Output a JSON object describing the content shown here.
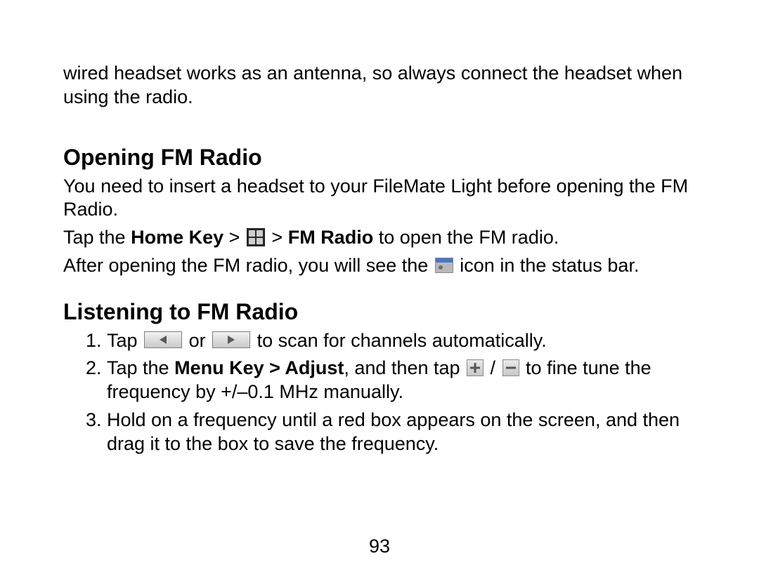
{
  "intro_para": "wired headset works as an antenna, so always connect the headset when using the radio.",
  "section_opening": {
    "heading": "Opening FM Radio",
    "para1": "You need to insert a headset to your FileMate Light before opening the FM Radio.",
    "tap_line": {
      "prefix": "Tap the ",
      "home_key_bold": "Home Key",
      "gt1": " > ",
      "gt2": " > ",
      "fm_radio_bold": "FM Radio",
      "suffix": " to open the FM radio."
    },
    "after_line": {
      "prefix": "After opening the FM radio, you will see the ",
      "suffix": " icon in the status bar."
    }
  },
  "section_listening": {
    "heading": "Listening to FM Radio",
    "step1": {
      "prefix": "Tap ",
      "or": " or ",
      "suffix": " to scan for channels automatically."
    },
    "step2": {
      "prefix": "Tap the ",
      "menu_adjust_bold": "Menu Key > Adjust",
      "mid": ", and then tap ",
      "slash": " / ",
      "suffix": " to fine tune the frequency by +/–0.1 MHz manually."
    },
    "step3": "Hold on a frequency until a red box appears on the screen, and then drag it to the box to save the frequency."
  },
  "page_number": "93"
}
